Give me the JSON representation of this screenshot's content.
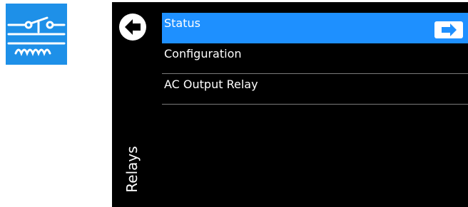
{
  "app_icon": {
    "name": "relay-icon",
    "color": "#1e90e8"
  },
  "screen": {
    "side_title": "Relays",
    "back_icon": "back-arrow-icon",
    "menu": [
      {
        "label": "Status",
        "selected": true,
        "action_icon": "enter-arrow-icon"
      },
      {
        "label": "Configuration",
        "selected": false
      },
      {
        "label": "AC Output Relay",
        "selected": false
      }
    ],
    "colors": {
      "background": "#000000",
      "selected": "#1e90ff",
      "divider": "#7a7a7a",
      "text": "#ffffff"
    }
  }
}
